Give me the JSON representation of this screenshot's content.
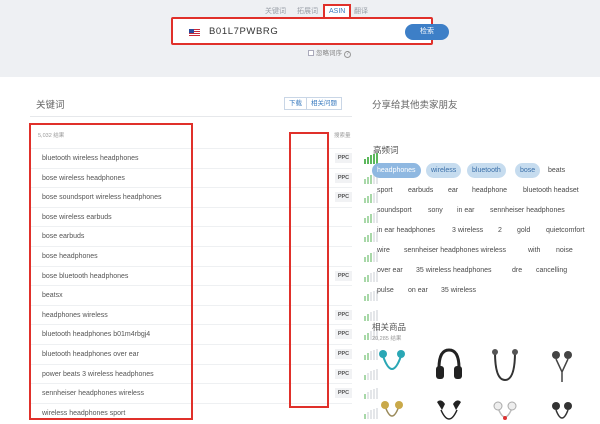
{
  "search": {
    "tabs": [
      {
        "label": "关键词",
        "active": false
      },
      {
        "label": "拓展词",
        "active": false
      },
      {
        "label": "ASIN",
        "active": true
      },
      {
        "label": "翻译",
        "active": false
      }
    ],
    "marketplace_flag": "us-flag",
    "value": "B01L7PWBRG",
    "button_label": "检索",
    "option_label": "忽略词序"
  },
  "keywords_panel": {
    "title": "关键词",
    "actions": [
      "下载",
      "相关问题"
    ],
    "results_count": "5,032 结果",
    "frequency_header": "搜索量",
    "ppc_label": "PPC",
    "rows": [
      {
        "keyword": "bluetooth wireless headphones",
        "ppc": true,
        "volume": 1.0
      },
      {
        "keyword": "bose wireless headphones",
        "ppc": true,
        "volume": 0.6
      },
      {
        "keyword": "bose soundsport wireless headphones",
        "ppc": true,
        "volume": 0.6
      },
      {
        "keyword": "bose wireless earbuds",
        "ppc": false,
        "volume": 0.6
      },
      {
        "keyword": "bose earbuds",
        "ppc": false,
        "volume": 0.6
      },
      {
        "keyword": "bose headphones",
        "ppc": false,
        "volume": 0.6
      },
      {
        "keyword": "bose bluetooth headphones",
        "ppc": true,
        "volume": 0.4
      },
      {
        "keyword": "beatsx",
        "ppc": false,
        "volume": 0.4
      },
      {
        "keyword": "headphones wireless",
        "ppc": true,
        "volume": 0.4
      },
      {
        "keyword": "bluetooth headphones b01m4rbgj4",
        "ppc": true,
        "volume": 0.4
      },
      {
        "keyword": "bluetooth headphones over ear",
        "ppc": true,
        "volume": 0.4
      },
      {
        "keyword": "power beats 3 wireless headphones",
        "ppc": true,
        "volume": 0.2
      },
      {
        "keyword": "sennheiser headphones wireless",
        "ppc": true,
        "volume": 0.2
      },
      {
        "keyword": "wireless headphones sport",
        "ppc": false,
        "volume": 0.2
      }
    ]
  },
  "share_panel": {
    "title": "分享给其他卖家朋友",
    "high_frequency_title": "高频词",
    "words": [
      "headphones",
      "wireless",
      "bluetooth",
      "bose",
      "beats",
      "sport",
      "earbuds",
      "ear",
      "headphone",
      "bluetooth headset",
      "soundsport",
      "sony",
      "in ear",
      "sennheiser headphones",
      "in ear headphones",
      "3 wireless",
      "2",
      "gold",
      "quietcomfort",
      "wire",
      "sennheiser headphones wireless",
      "with",
      "noise",
      "over ear",
      "35 wireless headphones",
      "dre",
      "cancelling",
      "pulse",
      "on ear",
      "35 wireless"
    ],
    "related_products_title": "相关商品",
    "related_products_count": "20,285 结果",
    "products": [
      "teal-earbuds",
      "black-over-ear-headphones",
      "black-neckband-earbuds",
      "black-earbuds-with-cable",
      "gold-earbuds",
      "black-sport-earbuds",
      "white-wired-earbuds",
      "dark-earbuds"
    ]
  },
  "colors": {
    "accent": "#3d7fc7",
    "annotation_red": "#e0302a",
    "bar_green_strong": "#5cb85c",
    "bar_green_light": "#a8d8a8",
    "chip_highlight": "#c6dcef",
    "chip_highlight_strong": "#8fb8e1"
  },
  "chart_data": {
    "type": "bar",
    "categories": [
      "bluetooth wireless headphones",
      "bose wireless headphones",
      "bose soundsport wireless headphones",
      "bose wireless earbuds",
      "bose earbuds",
      "bose headphones",
      "bose bluetooth headphones",
      "beatsx",
      "headphones wireless",
      "bluetooth headphones b01m4rbgj4",
      "bluetooth headphones over ear",
      "power beats 3 wireless headphones",
      "sennheiser headphones wireless",
      "wireless headphones sport"
    ],
    "values": [
      5,
      3,
      3,
      3,
      3,
      3,
      2,
      2,
      2,
      2,
      2,
      1,
      1,
      1
    ],
    "ylabel": "搜索量",
    "ylim": [
      0,
      5
    ]
  }
}
